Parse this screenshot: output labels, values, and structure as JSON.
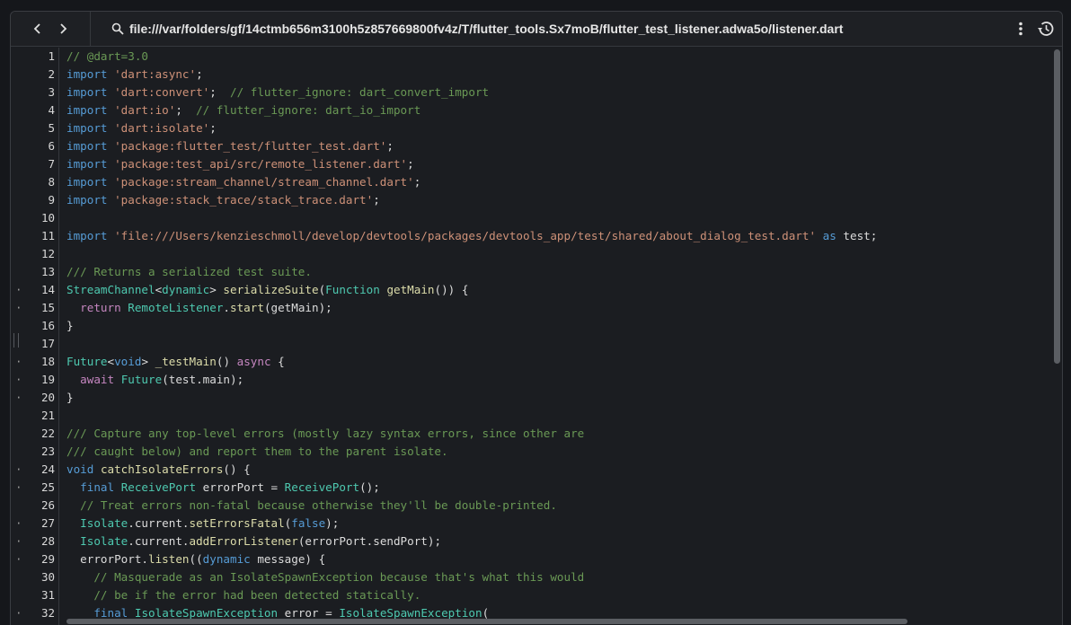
{
  "toolbar": {
    "back_icon": "chevron-left-icon",
    "forward_icon": "chevron-right-icon",
    "search_icon": "search-icon",
    "file_path": "file:///var/folders/gf/14ctmb656m3100h5z857669800fv4z/T/flutter_tools.Sx7moB/flutter_test_listener.adwa5o/listener.dart",
    "more_icon": "more-vert-icon",
    "history_icon": "history-icon"
  },
  "colors": {
    "comment": "#6a9955",
    "keyword": "#569cd6",
    "control": "#c586c0",
    "string": "#ce9178",
    "type": "#4ec9b0",
    "function": "#dcdcaa",
    "plain": "#dcdcdc"
  },
  "code_lines": [
    {
      "number": "1",
      "marker": "",
      "tokens": [
        [
          "comment",
          "// @dart=3.0"
        ]
      ]
    },
    {
      "number": "2",
      "marker": "",
      "tokens": [
        [
          "keyword",
          "import"
        ],
        [
          "plain",
          " "
        ],
        [
          "string",
          "'dart:async'"
        ],
        [
          "plain",
          ";"
        ]
      ]
    },
    {
      "number": "3",
      "marker": "",
      "tokens": [
        [
          "keyword",
          "import"
        ],
        [
          "plain",
          " "
        ],
        [
          "string",
          "'dart:convert'"
        ],
        [
          "plain",
          ";  "
        ],
        [
          "comment",
          "// flutter_ignore: dart_convert_import"
        ]
      ]
    },
    {
      "number": "4",
      "marker": "",
      "tokens": [
        [
          "keyword",
          "import"
        ],
        [
          "plain",
          " "
        ],
        [
          "string",
          "'dart:io'"
        ],
        [
          "plain",
          ";  "
        ],
        [
          "comment",
          "// flutter_ignore: dart_io_import"
        ]
      ]
    },
    {
      "number": "5",
      "marker": "",
      "tokens": [
        [
          "keyword",
          "import"
        ],
        [
          "plain",
          " "
        ],
        [
          "string",
          "'dart:isolate'"
        ],
        [
          "plain",
          ";"
        ]
      ]
    },
    {
      "number": "6",
      "marker": "",
      "tokens": [
        [
          "keyword",
          "import"
        ],
        [
          "plain",
          " "
        ],
        [
          "string",
          "'package:flutter_test/flutter_test.dart'"
        ],
        [
          "plain",
          ";"
        ]
      ]
    },
    {
      "number": "7",
      "marker": "",
      "tokens": [
        [
          "keyword",
          "import"
        ],
        [
          "plain",
          " "
        ],
        [
          "string",
          "'package:test_api/src/remote_listener.dart'"
        ],
        [
          "plain",
          ";"
        ]
      ]
    },
    {
      "number": "8",
      "marker": "",
      "tokens": [
        [
          "keyword",
          "import"
        ],
        [
          "plain",
          " "
        ],
        [
          "string",
          "'package:stream_channel/stream_channel.dart'"
        ],
        [
          "plain",
          ";"
        ]
      ]
    },
    {
      "number": "9",
      "marker": "",
      "tokens": [
        [
          "keyword",
          "import"
        ],
        [
          "plain",
          " "
        ],
        [
          "string",
          "'package:stack_trace/stack_trace.dart'"
        ],
        [
          "plain",
          ";"
        ]
      ]
    },
    {
      "number": "10",
      "marker": "",
      "tokens": []
    },
    {
      "number": "11",
      "marker": "",
      "tokens": [
        [
          "keyword",
          "import"
        ],
        [
          "plain",
          " "
        ],
        [
          "string",
          "'file:///Users/kenzieschmoll/develop/devtools/packages/devtools_app/test/shared/about_dialog_test.dart'"
        ],
        [
          "plain",
          " "
        ],
        [
          "keyword",
          "as"
        ],
        [
          "plain",
          " test;"
        ]
      ]
    },
    {
      "number": "12",
      "marker": "",
      "tokens": []
    },
    {
      "number": "13",
      "marker": "",
      "tokens": [
        [
          "comment",
          "/// Returns a serialized test suite."
        ]
      ]
    },
    {
      "number": "14",
      "marker": "·",
      "tokens": [
        [
          "type",
          "StreamChannel"
        ],
        [
          "plain",
          "<"
        ],
        [
          "type",
          "dynamic"
        ],
        [
          "plain",
          "> "
        ],
        [
          "func",
          "serializeSuite"
        ],
        [
          "plain",
          "("
        ],
        [
          "type",
          "Function"
        ],
        [
          "plain",
          " "
        ],
        [
          "func",
          "getMain"
        ],
        [
          "plain",
          "()) {"
        ]
      ]
    },
    {
      "number": "15",
      "marker": "·",
      "tokens": [
        [
          "plain",
          "  "
        ],
        [
          "control",
          "return"
        ],
        [
          "plain",
          " "
        ],
        [
          "type",
          "RemoteListener"
        ],
        [
          "plain",
          "."
        ],
        [
          "func",
          "start"
        ],
        [
          "plain",
          "(getMain);"
        ]
      ]
    },
    {
      "number": "16",
      "marker": "",
      "tokens": [
        [
          "plain",
          "}"
        ]
      ]
    },
    {
      "number": "17",
      "marker": "",
      "tokens": []
    },
    {
      "number": "18",
      "marker": "·",
      "tokens": [
        [
          "type",
          "Future"
        ],
        [
          "plain",
          "<"
        ],
        [
          "keyword",
          "void"
        ],
        [
          "plain",
          "> "
        ],
        [
          "func",
          "_testMain"
        ],
        [
          "plain",
          "() "
        ],
        [
          "control",
          "async"
        ],
        [
          "plain",
          " {"
        ]
      ]
    },
    {
      "number": "19",
      "marker": "·",
      "tokens": [
        [
          "plain",
          "  "
        ],
        [
          "control",
          "await"
        ],
        [
          "plain",
          " "
        ],
        [
          "type",
          "Future"
        ],
        [
          "plain",
          "(test.main);"
        ]
      ]
    },
    {
      "number": "20",
      "marker": "·",
      "tokens": [
        [
          "plain",
          "}"
        ]
      ]
    },
    {
      "number": "21",
      "marker": "",
      "tokens": []
    },
    {
      "number": "22",
      "marker": "",
      "tokens": [
        [
          "comment",
          "/// Capture any top-level errors (mostly lazy syntax errors, since other are"
        ]
      ]
    },
    {
      "number": "23",
      "marker": "",
      "tokens": [
        [
          "comment",
          "/// caught below) and report them to the parent isolate."
        ]
      ]
    },
    {
      "number": "24",
      "marker": "·",
      "tokens": [
        [
          "keyword",
          "void"
        ],
        [
          "plain",
          " "
        ],
        [
          "func",
          "catchIsolateErrors"
        ],
        [
          "plain",
          "() {"
        ]
      ]
    },
    {
      "number": "25",
      "marker": "·",
      "tokens": [
        [
          "plain",
          "  "
        ],
        [
          "keyword",
          "final"
        ],
        [
          "plain",
          " "
        ],
        [
          "type",
          "ReceivePort"
        ],
        [
          "plain",
          " errorPort = "
        ],
        [
          "type",
          "ReceivePort"
        ],
        [
          "plain",
          "();"
        ]
      ]
    },
    {
      "number": "26",
      "marker": "",
      "tokens": [
        [
          "plain",
          "  "
        ],
        [
          "comment",
          "// Treat errors non-fatal because otherwise they'll be double-printed."
        ]
      ]
    },
    {
      "number": "27",
      "marker": "·",
      "tokens": [
        [
          "plain",
          "  "
        ],
        [
          "type",
          "Isolate"
        ],
        [
          "plain",
          ".current."
        ],
        [
          "func",
          "setErrorsFatal"
        ],
        [
          "plain",
          "("
        ],
        [
          "keyword",
          "false"
        ],
        [
          "plain",
          ");"
        ]
      ]
    },
    {
      "number": "28",
      "marker": "·",
      "tokens": [
        [
          "plain",
          "  "
        ],
        [
          "type",
          "Isolate"
        ],
        [
          "plain",
          ".current."
        ],
        [
          "func",
          "addErrorListener"
        ],
        [
          "plain",
          "(errorPort.sendPort);"
        ]
      ]
    },
    {
      "number": "29",
      "marker": "·",
      "tokens": [
        [
          "plain",
          "  errorPort."
        ],
        [
          "func",
          "listen"
        ],
        [
          "plain",
          "(("
        ],
        [
          "keyword",
          "dynamic"
        ],
        [
          "plain",
          " message) {"
        ]
      ]
    },
    {
      "number": "30",
      "marker": "",
      "tokens": [
        [
          "plain",
          "    "
        ],
        [
          "comment",
          "// Masquerade as an IsolateSpawnException because that's what this would"
        ]
      ]
    },
    {
      "number": "31",
      "marker": "",
      "tokens": [
        [
          "plain",
          "    "
        ],
        [
          "comment",
          "// be if the error had been detected statically."
        ]
      ]
    },
    {
      "number": "32",
      "marker": "·",
      "tokens": [
        [
          "plain",
          "    "
        ],
        [
          "keyword",
          "final"
        ],
        [
          "plain",
          " "
        ],
        [
          "type",
          "IsolateSpawnException"
        ],
        [
          "plain",
          " error = "
        ],
        [
          "type",
          "IsolateSpawnException"
        ],
        [
          "plain",
          "("
        ]
      ]
    }
  ]
}
